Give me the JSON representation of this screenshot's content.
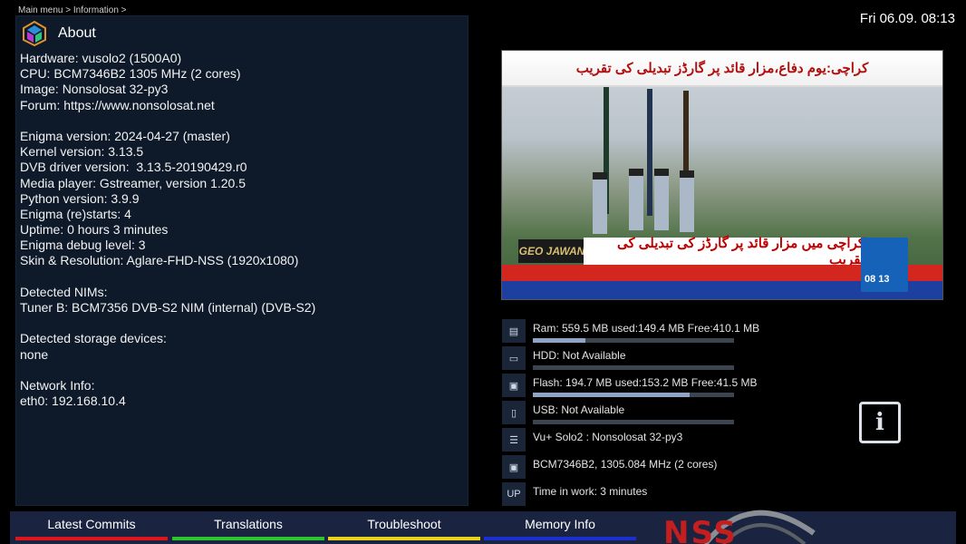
{
  "breadcrumb": "Main menu > Information >",
  "clock": "Fri 06.09.  08:13",
  "panel": {
    "title": "About",
    "lines": [
      "Hardware: vusolo2 (1500A0)",
      "CPU: BCM7346B2 1305 MHz (2 cores)",
      "Image: Nonsolosat 32-py3",
      "Forum: https://www.nonsolosat.net",
      "",
      "Enigma version: 2024-04-27 (master)",
      "Kernel version: 3.13.5",
      "DVB driver version:  3.13.5-20190429.r0",
      "Media player: Gstreamer, version 1.20.5",
      "Python version: 3.9.9",
      "Enigma (re)starts: 4",
      "Uptime: 0 hours 3 minutes",
      "Enigma debug level: 3",
      "Skin & Resolution: Aglare-FHD-NSS (1920x1080)",
      "",
      "Detected NIMs:",
      "Tuner B: BCM7356 DVB-S2 NIM (internal) (DVB-S2)",
      "",
      "Detected storage devices:",
      "none",
      "",
      "Network Info:",
      "eth0: 192.168.10.4"
    ]
  },
  "tv": {
    "headline_top": "کراچی:یوم دفاع،مزار قائد پر گارڈز تبدیلی کی تقریب",
    "headline_lower": "کراچی میں مزار قائد پر گارڈز کی تبدیلی کی تقریب",
    "brand": "GEO JAWAN",
    "time": "08 13"
  },
  "stats": [
    {
      "icon": "ram-icon",
      "glyph": "▤",
      "label": "Ram: 559.5 MB used:149.4 MB Free:410.1 MB",
      "bar": 0.26
    },
    {
      "icon": "hdd-icon",
      "glyph": "▭",
      "label": "HDD: Not Available",
      "bar": 0
    },
    {
      "icon": "flash-icon",
      "glyph": "▣",
      "label": "Flash: 194.7 MB used:153.2 MB Free:41.5 MB",
      "bar": 0.78
    },
    {
      "icon": "usb-icon",
      "glyph": "▯",
      "label": "USB: Not Available",
      "bar": 0
    },
    {
      "icon": "receiver-icon",
      "glyph": "☰",
      "label": "Vu+ Solo2 : Nonsolosat 32-py3"
    },
    {
      "icon": "cpu-icon",
      "glyph": "▣",
      "label": "BCM7346B2, 1305.084 MHz (2 cores)"
    },
    {
      "icon": "uptime-icon",
      "glyph": "UP",
      "label": "Time in work: 3 minutes"
    }
  ],
  "info_button": "i",
  "buttons": [
    {
      "label": "Latest Commits",
      "color": "#e0141c"
    },
    {
      "label": "Translations",
      "color": "#2ec42e"
    },
    {
      "label": "Troubleshoot",
      "color": "#e8d21a"
    },
    {
      "label": "Memory Info",
      "color": "#1a2fd0"
    }
  ],
  "nss_logo": "NSS"
}
